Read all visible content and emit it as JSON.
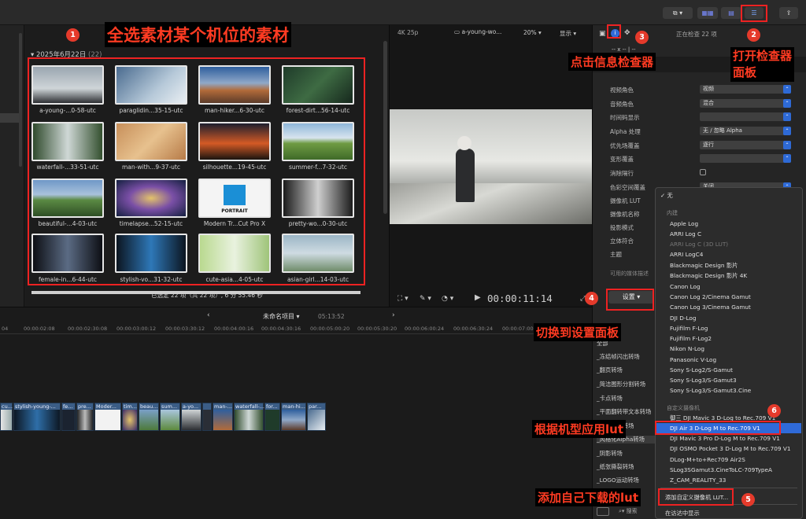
{
  "toolbar": {
    "share_icon": "share-icon"
  },
  "browser": {
    "date_header": "2025年6月22日",
    "count": "(22)",
    "footer": "已选定 22 项（共 22 项）, 6 分 55.46 秒",
    "clips": [
      "a-young-...0-58-utc",
      "paraglidin...35-15-utc",
      "man-hiker...6-30-utc",
      "forest-dirt...56-14-utc",
      "waterfall-...33-51-utc",
      "man-with...9-37-utc",
      "silhouette...19-45-utc",
      "summer-f...7-32-utc",
      "beautiful-...4-03-utc",
      "timelapse...52-15-utc",
      "Modern Tr...Cut Pro X",
      "pretty-wo...0-30-utc",
      "female-in...6-44-utc",
      "stylish-vo...31-32-utc",
      "cute-asia...4-05-utc",
      "asian-girl...14-03-utc"
    ],
    "portrait_label": "PORTRAIT"
  },
  "viewer": {
    "format": "4K 25p",
    "clip_name": "a-young-wo...",
    "zoom": "20%",
    "display": "显示",
    "timecode": "00:00:11:14"
  },
  "inspector": {
    "status": "正在检查 22 项",
    "divider": "-- x -- | --",
    "rows": [
      {
        "label": "视频角色",
        "value": "视频"
      },
      {
        "label": "音频角色",
        "value": "混合"
      },
      {
        "label": "时间码显示",
        "value": ""
      },
      {
        "label": "Alpha 处理",
        "value": "无 / 忽略 Alpha"
      },
      {
        "label": "优先场覆盖",
        "value": "逐行"
      },
      {
        "label": "变形覆盖",
        "value": ""
      },
      {
        "label": "消除隔行",
        "value": ""
      },
      {
        "label": "色彩空间覆盖",
        "value": "关闭"
      },
      {
        "label": "摄像机 LUT",
        "value": ""
      },
      {
        "label": "摄像机名称",
        "value": ""
      },
      {
        "label": "投影模式",
        "value": ""
      },
      {
        "label": "立体符合",
        "value": ""
      },
      {
        "label": "主题",
        "value": ""
      }
    ],
    "media_note": "可用的媒体描述",
    "settings": "设置"
  },
  "lut_menu": {
    "none": "无",
    "builtin_header": "内建",
    "builtin": [
      "Apple Log",
      "ARRI Log C",
      "ARRI Log C (3D LUT)",
      "ARRI LogC4",
      "Blackmagic Design 影片",
      "Blackmagic Design 影片 4K",
      "Canon Log",
      "Canon Log 2/Cinema Gamut",
      "Canon Log 3/Cinema Gamut",
      "DJI D-Log",
      "Fujifilm F-Log",
      "Fujifilm F-Log2",
      "Nikon N-Log",
      "Panasonic V-Log",
      "Sony S-Log2/S-Gamut",
      "Sony S-Log3/S-Gamut3",
      "Sony S-Log3/S-Gamut3.Cine"
    ],
    "custom_header": "自定义摄像机",
    "custom": [
      "御三 DJI Mavic 3 D-Log to Rec.709 V1",
      "DJI Air 3 D-Log M to Rec.709 V1",
      "DJI Mavic 3 Pro D-Log M to Rec.709 V1",
      "DJI OSMO Pocket 3 D-Log M to Rec.709 V1",
      "DLog-M+to+Rec709 Air2S",
      "SLog3SGamut3.CineToLC-709TypeA",
      "Z_CAM_REALITY_33"
    ],
    "add_custom": "添加自定义摄像机 LUT...",
    "show_finder": "在访达中显示"
  },
  "transitions": {
    "items": [
      "全部",
      "_冻结帧闪出转场",
      "_翻页转场",
      "_简洁图形分割转场",
      "_卡点转场",
      "_平面翻转带文本转场",
      "_四个移动转场",
      "_风格化Alpha转场",
      "_阴影转场",
      "_纸张撕裂转场",
      "_LOGO运动转场"
    ],
    "search": "搜索"
  },
  "timeline": {
    "project": "未命名项目",
    "duration": "05:13:52",
    "ruler": [
      "04",
      "00:00:02:08",
      "00:00:02:30:08",
      "00:00:03:00:12",
      "00:00:03:30:12",
      "00:00:04:00:16",
      "00:00:04:30:16",
      "00:00:05:00:20",
      "00:00:05:30:20",
      "00:00:06:00:24",
      "00:00:06:30:24",
      "00:00:07:00:"
    ],
    "clips": [
      "cu...",
      "stylish-young-...",
      "fe...",
      "pre...",
      "Moder...",
      "tim...",
      "beau...",
      "sum...",
      "a-yo...",
      "man-...",
      "waterfall-...",
      "for...",
      "man-hi...",
      "par..."
    ]
  },
  "annotations": {
    "a1": "全选素材某个机位的素材",
    "a2": "打开检查器\n面板",
    "a3": "点击信息检查器",
    "a4": "切换到设置面板",
    "a6": "根据机型应用lut",
    "a5": "添加自己下载的lut",
    "n1": "1",
    "n2": "2",
    "n3": "3",
    "n4": "4",
    "n5": "5",
    "n6": "6"
  }
}
